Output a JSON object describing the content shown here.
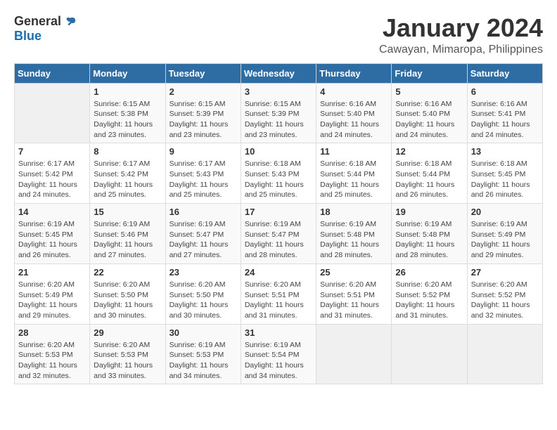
{
  "logo": {
    "general": "General",
    "blue": "Blue"
  },
  "title": "January 2024",
  "subtitle": "Cawayan, Mimaropa, Philippines",
  "days_header": [
    "Sunday",
    "Monday",
    "Tuesday",
    "Wednesday",
    "Thursday",
    "Friday",
    "Saturday"
  ],
  "weeks": [
    [
      {
        "num": "",
        "detail": ""
      },
      {
        "num": "1",
        "detail": "Sunrise: 6:15 AM\nSunset: 5:38 PM\nDaylight: 11 hours\nand 23 minutes."
      },
      {
        "num": "2",
        "detail": "Sunrise: 6:15 AM\nSunset: 5:39 PM\nDaylight: 11 hours\nand 23 minutes."
      },
      {
        "num": "3",
        "detail": "Sunrise: 6:15 AM\nSunset: 5:39 PM\nDaylight: 11 hours\nand 23 minutes."
      },
      {
        "num": "4",
        "detail": "Sunrise: 6:16 AM\nSunset: 5:40 PM\nDaylight: 11 hours\nand 24 minutes."
      },
      {
        "num": "5",
        "detail": "Sunrise: 6:16 AM\nSunset: 5:40 PM\nDaylight: 11 hours\nand 24 minutes."
      },
      {
        "num": "6",
        "detail": "Sunrise: 6:16 AM\nSunset: 5:41 PM\nDaylight: 11 hours\nand 24 minutes."
      }
    ],
    [
      {
        "num": "7",
        "detail": "Sunrise: 6:17 AM\nSunset: 5:42 PM\nDaylight: 11 hours\nand 24 minutes."
      },
      {
        "num": "8",
        "detail": "Sunrise: 6:17 AM\nSunset: 5:42 PM\nDaylight: 11 hours\nand 25 minutes."
      },
      {
        "num": "9",
        "detail": "Sunrise: 6:17 AM\nSunset: 5:43 PM\nDaylight: 11 hours\nand 25 minutes."
      },
      {
        "num": "10",
        "detail": "Sunrise: 6:18 AM\nSunset: 5:43 PM\nDaylight: 11 hours\nand 25 minutes."
      },
      {
        "num": "11",
        "detail": "Sunrise: 6:18 AM\nSunset: 5:44 PM\nDaylight: 11 hours\nand 25 minutes."
      },
      {
        "num": "12",
        "detail": "Sunrise: 6:18 AM\nSunset: 5:44 PM\nDaylight: 11 hours\nand 26 minutes."
      },
      {
        "num": "13",
        "detail": "Sunrise: 6:18 AM\nSunset: 5:45 PM\nDaylight: 11 hours\nand 26 minutes."
      }
    ],
    [
      {
        "num": "14",
        "detail": "Sunrise: 6:19 AM\nSunset: 5:45 PM\nDaylight: 11 hours\nand 26 minutes."
      },
      {
        "num": "15",
        "detail": "Sunrise: 6:19 AM\nSunset: 5:46 PM\nDaylight: 11 hours\nand 27 minutes."
      },
      {
        "num": "16",
        "detail": "Sunrise: 6:19 AM\nSunset: 5:47 PM\nDaylight: 11 hours\nand 27 minutes."
      },
      {
        "num": "17",
        "detail": "Sunrise: 6:19 AM\nSunset: 5:47 PM\nDaylight: 11 hours\nand 28 minutes."
      },
      {
        "num": "18",
        "detail": "Sunrise: 6:19 AM\nSunset: 5:48 PM\nDaylight: 11 hours\nand 28 minutes."
      },
      {
        "num": "19",
        "detail": "Sunrise: 6:19 AM\nSunset: 5:48 PM\nDaylight: 11 hours\nand 28 minutes."
      },
      {
        "num": "20",
        "detail": "Sunrise: 6:19 AM\nSunset: 5:49 PM\nDaylight: 11 hours\nand 29 minutes."
      }
    ],
    [
      {
        "num": "21",
        "detail": "Sunrise: 6:20 AM\nSunset: 5:49 PM\nDaylight: 11 hours\nand 29 minutes."
      },
      {
        "num": "22",
        "detail": "Sunrise: 6:20 AM\nSunset: 5:50 PM\nDaylight: 11 hours\nand 30 minutes."
      },
      {
        "num": "23",
        "detail": "Sunrise: 6:20 AM\nSunset: 5:50 PM\nDaylight: 11 hours\nand 30 minutes."
      },
      {
        "num": "24",
        "detail": "Sunrise: 6:20 AM\nSunset: 5:51 PM\nDaylight: 11 hours\nand 31 minutes."
      },
      {
        "num": "25",
        "detail": "Sunrise: 6:20 AM\nSunset: 5:51 PM\nDaylight: 11 hours\nand 31 minutes."
      },
      {
        "num": "26",
        "detail": "Sunrise: 6:20 AM\nSunset: 5:52 PM\nDaylight: 11 hours\nand 31 minutes."
      },
      {
        "num": "27",
        "detail": "Sunrise: 6:20 AM\nSunset: 5:52 PM\nDaylight: 11 hours\nand 32 minutes."
      }
    ],
    [
      {
        "num": "28",
        "detail": "Sunrise: 6:20 AM\nSunset: 5:53 PM\nDaylight: 11 hours\nand 32 minutes."
      },
      {
        "num": "29",
        "detail": "Sunrise: 6:20 AM\nSunset: 5:53 PM\nDaylight: 11 hours\nand 33 minutes."
      },
      {
        "num": "30",
        "detail": "Sunrise: 6:19 AM\nSunset: 5:53 PM\nDaylight: 11 hours\nand 34 minutes."
      },
      {
        "num": "31",
        "detail": "Sunrise: 6:19 AM\nSunset: 5:54 PM\nDaylight: 11 hours\nand 34 minutes."
      },
      {
        "num": "",
        "detail": ""
      },
      {
        "num": "",
        "detail": ""
      },
      {
        "num": "",
        "detail": ""
      }
    ]
  ]
}
